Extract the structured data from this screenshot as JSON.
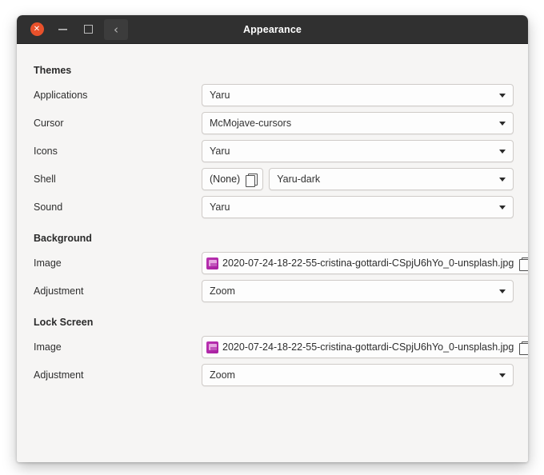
{
  "window": {
    "title": "Appearance",
    "titlebar_buttons": [
      {
        "name": "close",
        "icon": "close-icon",
        "glyph": "✕"
      },
      {
        "name": "minimize",
        "icon": "minimize-icon",
        "glyph": ""
      },
      {
        "name": "maximize",
        "icon": "maximize-icon",
        "glyph": ""
      },
      {
        "name": "back",
        "icon": "back-chevron-icon",
        "glyph": "‹"
      }
    ],
    "colors": {
      "titlebar_bg": "#303030",
      "close_button": "#e8512b",
      "content_bg": "#f6f5f4",
      "field_bg": "#fdfdfd",
      "field_border": "#cfcbc8",
      "image_icon": "#bb33b2"
    }
  },
  "sections": {
    "themes": {
      "heading": "Themes",
      "rows": [
        {
          "label": "Applications",
          "value": "Yaru"
        },
        {
          "label": "Cursor",
          "value": "McMojave-cursors"
        },
        {
          "label": "Icons",
          "value": "Yaru"
        },
        {
          "label": "Shell",
          "value": "Yaru-dark",
          "extra_button": "(None)"
        },
        {
          "label": "Sound",
          "value": "Yaru"
        }
      ]
    },
    "background": {
      "heading": "Background",
      "image_label": "Image",
      "image_value": "2020-07-24-18-22-55-cristina-gottardi-CSpjU6hYo_0-unsplash.jpg",
      "adjustment_label": "Adjustment",
      "adjustment_value": "Zoom"
    },
    "lock_screen": {
      "heading": "Lock Screen",
      "image_label": "Image",
      "image_value": "2020-07-24-18-22-55-cristina-gottardi-CSpjU6hYo_0-unsplash.jpg",
      "adjustment_label": "Adjustment",
      "adjustment_value": "Zoom"
    }
  }
}
